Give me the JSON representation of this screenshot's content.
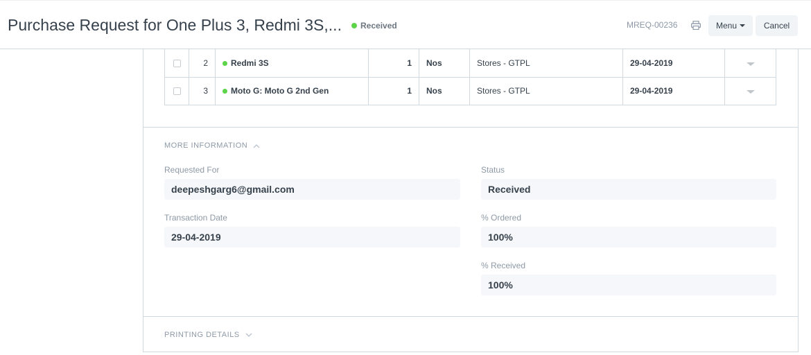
{
  "header": {
    "title": "Purchase Request for One Plus 3, Redmi 3S,...",
    "status": "Received",
    "status_color": "#5ed44a",
    "doc_name": "MREQ-00236",
    "menu_label": "Menu",
    "cancel_label": "Cancel"
  },
  "items": [
    {
      "idx": "2",
      "item": "Redmi 3S",
      "qty": "1",
      "uom": "Nos",
      "warehouse": "Stores - GTPL",
      "date": "29-04-2019"
    },
    {
      "idx": "3",
      "item": "Moto G: Moto G 2nd Gen",
      "qty": "1",
      "uom": "Nos",
      "warehouse": "Stores - GTPL",
      "date": "29-04-2019"
    }
  ],
  "more_info": {
    "heading": "MORE INFORMATION",
    "requested_for_label": "Requested For",
    "requested_for_value": "deepeshgarg6@gmail.com",
    "transaction_date_label": "Transaction Date",
    "transaction_date_value": "29-04-2019",
    "status_label": "Status",
    "status_value": "Received",
    "ordered_label": "% Ordered",
    "ordered_value": "100%",
    "received_label": "% Received",
    "received_value": "100%"
  },
  "printing": {
    "heading": "PRINTING DETAILS"
  }
}
